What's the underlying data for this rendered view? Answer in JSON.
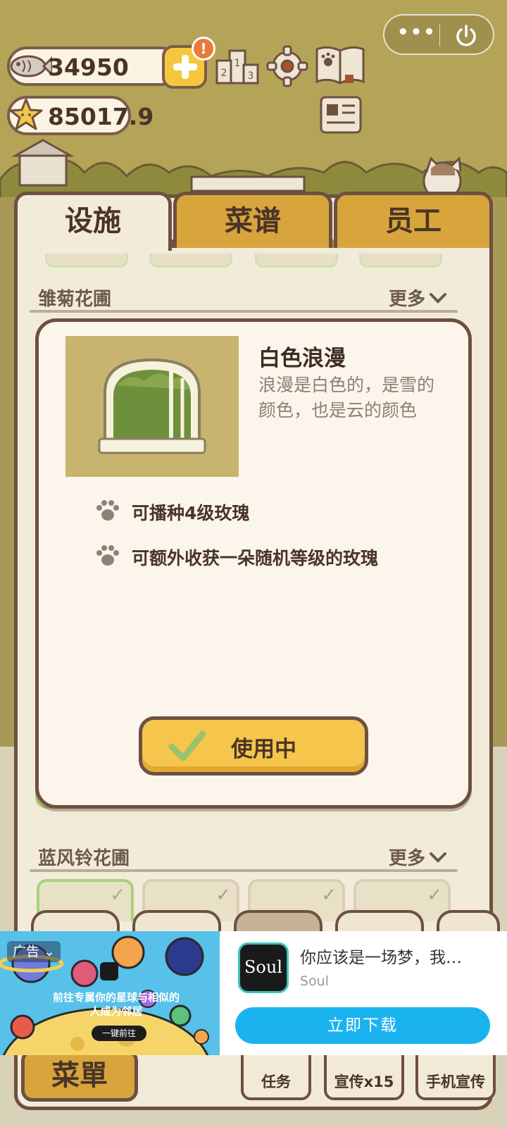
{
  "hud": {
    "fish_amount": "34950",
    "star_amount": "85017.9",
    "alert_badge": "!",
    "menu_dots": "•••"
  },
  "tabs": {
    "facility": "设施",
    "recipe": "菜谱",
    "staff": "员工",
    "active": "facility"
  },
  "sections": [
    {
      "title": "雏菊花圃",
      "more": "更多"
    },
    {
      "title": "蓝风铃花圃",
      "more": "更多"
    }
  ],
  "modal": {
    "title": "白色浪漫",
    "description": "浪漫是白色的，是雪的颜色，也是云的颜色",
    "features": [
      "可播种4级玫瑰",
      "可额外收获一朵随机等级的玫瑰"
    ],
    "button_label": "使用中"
  },
  "bottom": {
    "menu_label": "菜單",
    "task_label": "任务",
    "promo_label": "宣传x15",
    "phone_promo_label": "手机宣传"
  },
  "ad": {
    "tag": "广告",
    "image_caption": "前往专属你的星球与相似的人成为邻居",
    "image_cta": "一键前往",
    "logo_text": "Soul",
    "title": "你应该是一场梦，我…",
    "brand": "Soul",
    "download_label": "立即下载"
  },
  "colors": {
    "panel": "#f3ebd9",
    "border": "#6e5040",
    "tab_inactive": "#d7a53c",
    "button_yellow": "#f6c54b",
    "ad_button": "#1ab3f0"
  }
}
